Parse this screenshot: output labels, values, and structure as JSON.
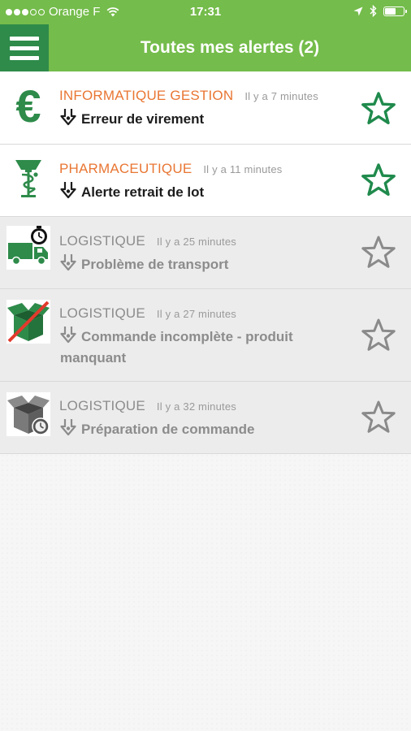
{
  "status_bar": {
    "carrier": "Orange F",
    "time": "17:31"
  },
  "header": {
    "title": "Toutes mes alertes (2)",
    "menu_icon": "hamburger-menu-icon"
  },
  "colors": {
    "brand_green": "#74bc4b",
    "dark_green": "#2e8b4a",
    "category_unread": "#e97633",
    "category_read": "#8c8c8c"
  },
  "alerts": [
    {
      "category": "INFORMATIQUE GESTION",
      "time": "Il y a 7 minutes",
      "subject": "Erreur de virement",
      "icon": "euro-icon",
      "read": false,
      "starred": true
    },
    {
      "category": "PHARMACEUTIQUE",
      "time": "Il y a 11 minutes",
      "subject": "Alerte retrait de lot",
      "icon": "caduceus-icon",
      "read": false,
      "starred": true
    },
    {
      "category": "LOGISTIQUE",
      "time": "Il y a 25 minutes",
      "subject": "Problème de transport",
      "icon": "truck-timer-icon",
      "read": true,
      "starred": false
    },
    {
      "category": "LOGISTIQUE",
      "time": "Il y a 27 minutes",
      "subject": "Commande incomplète - produit manquant",
      "icon": "box-crossed-icon",
      "read": true,
      "starred": false
    },
    {
      "category": "LOGISTIQUE",
      "time": "Il y a 32 minutes",
      "subject": "Préparation de commande",
      "icon": "box-timer-icon",
      "read": true,
      "starred": false
    }
  ]
}
